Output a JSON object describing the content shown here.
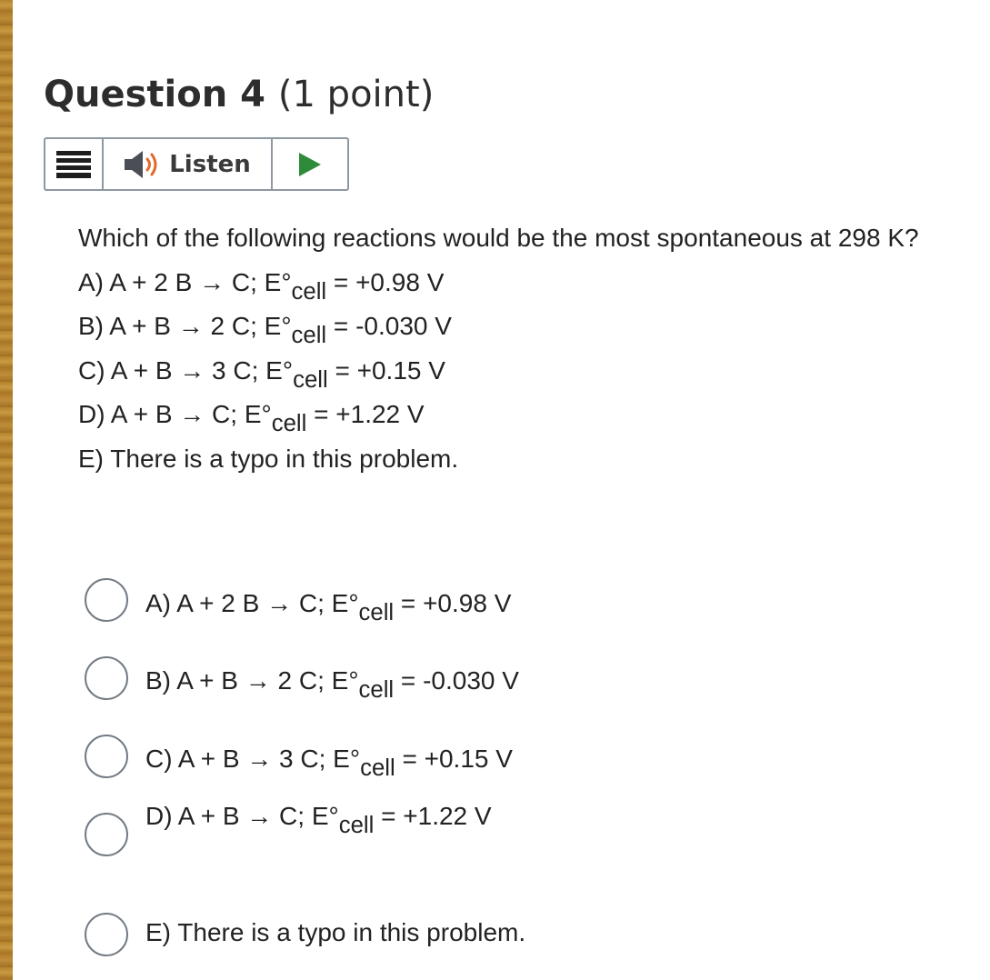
{
  "question": {
    "label": "Question 4",
    "points": "(1 point)"
  },
  "toolbar": {
    "menu_icon": "hamburger-menu-icon",
    "listen_icon": "speaker-icon",
    "listen_label": "Listen",
    "play_icon": "play-icon",
    "colors": {
      "speaker": "#4a4f57",
      "speaker_waves": "#e06a2c",
      "play": "#2e8b3a"
    }
  },
  "stem": {
    "prompt": "Which of the following reactions would be the most spontaneous at 298 K?",
    "choices": [
      {
        "pre": "A) A + 2 B → C; E°",
        "sub": "cell",
        "post": " = +0.98 V"
      },
      {
        "pre": "B) A + B → 2 C; E°",
        "sub": "cell",
        "post": " = -0.030 V"
      },
      {
        "pre": "C) A + B → 3 C; E°",
        "sub": "cell",
        "post": " = +0.15 V"
      },
      {
        "pre": "D) A + B → C; E°",
        "sub": "cell",
        "post": " = +1.22 V"
      },
      {
        "text": "E) There is a typo in this problem."
      }
    ]
  },
  "options": [
    {
      "pre": "A) A + 2 B → C; E°",
      "sub": "cell",
      "post": " = +0.98 V",
      "selected": false
    },
    {
      "pre": "B) A + B → 2 C; E°",
      "sub": "cell",
      "post": " = -0.030 V",
      "selected": false
    },
    {
      "pre": "C) A + B → 3 C; E°",
      "sub": "cell",
      "post": " = +0.15 V",
      "selected": false
    },
    {
      "pre": "D) A + B → C; E°",
      "sub": "cell",
      "post": " = +1.22 V",
      "selected": false
    },
    {
      "text": "E) There is a typo in this problem.",
      "selected": false
    }
  ]
}
